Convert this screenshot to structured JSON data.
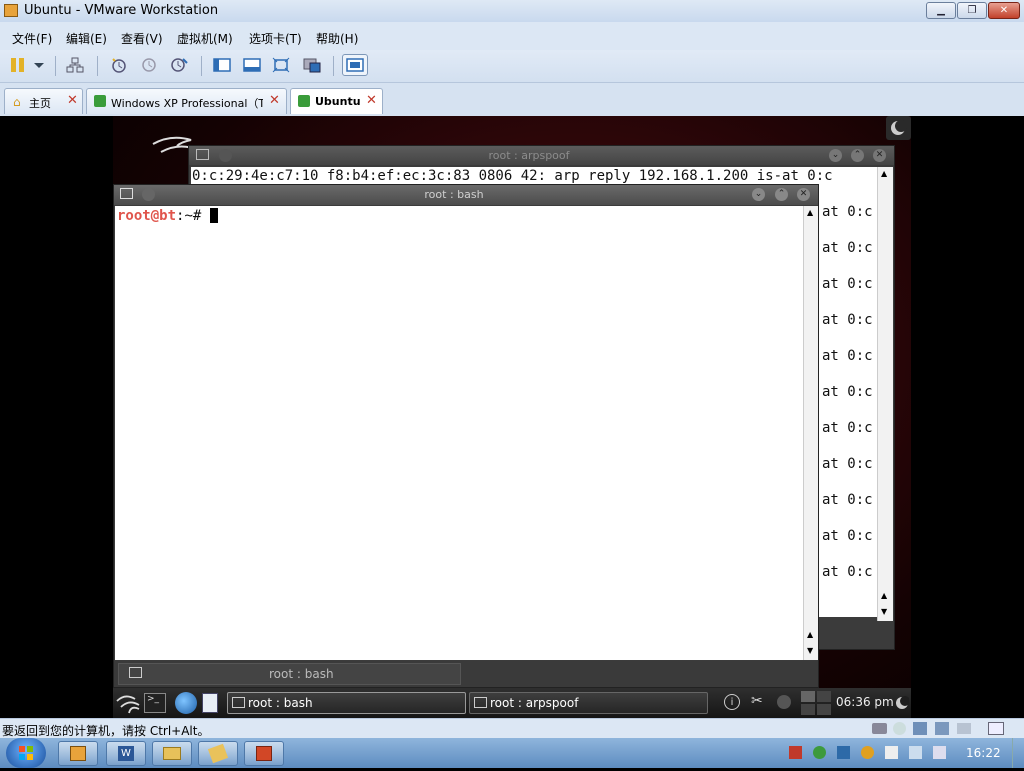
{
  "window": {
    "title": "Ubuntu - VMware Workstation"
  },
  "menu": [
    "文件(F)",
    "编辑(E)",
    "查看(V)",
    "虚拟机(M)",
    "选项卡(T)",
    "帮助(H)"
  ],
  "tabs": [
    {
      "label": "主页",
      "active": false
    },
    {
      "label": "Windows XP Professional（Te…",
      "active": false
    },
    {
      "label": "Ubuntu",
      "active": true
    }
  ],
  "term_arpspoof": {
    "title": "root : arpspoof",
    "first_line": "0:c:29:4e:c7:10 f8:b4:ef:ec:3c:83 0806 42: arp reply 192.168.1.200 is-at 0:c",
    "line_tail": "at 0:c",
    "tail_count": 11
  },
  "term_bash": {
    "title": "root : bash",
    "prompt_user": "root@bt",
    "prompt_rest": ":~# ",
    "bottom_tab": "root : bash"
  },
  "kde_panel": {
    "tasks": [
      "root : bash",
      "root : arpspoof"
    ],
    "clock": "06:36 pm"
  },
  "statusbar": {
    "hint": "要返回到您的计算机，请按 Ctrl+Alt。"
  },
  "win_taskbar": {
    "clock": "16:22"
  },
  "colors": {
    "prompt_red": "#e0554c",
    "accent_blue": "#2e6db5"
  }
}
